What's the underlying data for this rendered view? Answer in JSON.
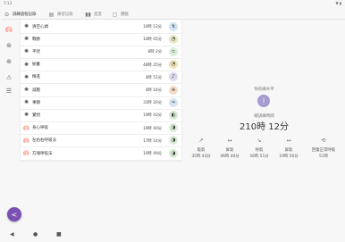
{
  "status": {
    "time": "7:13",
    "icons": "▼ ▮"
  },
  "tabs": [
    {
      "label": "訓練過程記錄",
      "icon": "⊙",
      "active": true
    },
    {
      "label": "練習記錄",
      "icon": "▤",
      "active": false
    },
    {
      "label": "進度",
      "icon": "▮▮",
      "active": false
    },
    {
      "label": "體驗",
      "icon": "▢",
      "active": false
    }
  ],
  "rail_icons": [
    "🫁",
    "⊛",
    "⊕",
    "⚠",
    "☰"
  ],
  "exercises": [
    {
      "name": "清空心頭",
      "duration": "10時 13分",
      "icon": "✺",
      "circle_color": "#cfe3f4",
      "circle_icon": "↯"
    },
    {
      "name": "戰勝",
      "duration": "10時 45分",
      "icon": "✺",
      "circle_color": "#e8e6c3",
      "circle_icon": "◔"
    },
    {
      "name": "平伏",
      "duration": "6時 2分",
      "icon": "✺",
      "circle_color": "#d9edd9",
      "circle_icon": "⊂"
    },
    {
      "name": "振奮",
      "duration": "46時 25分",
      "icon": "✺",
      "circle_color": "#efe2b8",
      "circle_icon": "◔"
    },
    {
      "name": "精進",
      "duration": "4時 51分",
      "icon": "✺",
      "circle_color": "#dcd7ef",
      "circle_icon": "♪"
    },
    {
      "name": "減壓",
      "duration": "4時 16分",
      "icon": "✺",
      "circle_color": "#f4dcc6",
      "circle_icon": "≋"
    },
    {
      "name": "事靜",
      "duration": "31時 20分",
      "icon": "✺",
      "circle_color": "#d5e2f2",
      "circle_icon": "≈"
    },
    {
      "name": "覺悟",
      "duration": "19時 43分",
      "icon": "✺",
      "circle_color": "#d3ead0",
      "circle_icon": "◐"
    },
    {
      "name": "身心呼吸",
      "duration": "19時 40分",
      "icon": "🫁",
      "circle_color": "#d9ecd6",
      "circle_icon": "◑"
    },
    {
      "name": "左右右呼吸法",
      "duration": "17時 14分",
      "icon": "🫁",
      "circle_color": "#d9ecd6",
      "circle_icon": "◑"
    },
    {
      "name": "方塊呼吸法",
      "duration": "10時 49分",
      "icon": "🫁",
      "circle_color": "#d9ecd6",
      "circle_icon": "◑"
    }
  ],
  "summary": {
    "level_label": "你的練水平",
    "level_value": "I",
    "total_label": "總訓練時間",
    "total_value": "210時 12分"
  },
  "stats": [
    {
      "icon": "↗",
      "label": "吸氣",
      "value": "35時 43分"
    },
    {
      "icon": "↔",
      "label": "屏氣",
      "value": "46時 40分"
    },
    {
      "icon": "↘",
      "label": "呼氣",
      "value": "56時 51分"
    },
    {
      "icon": "↔",
      "label": "屏氣",
      "value": "19時 56分"
    },
    {
      "icon": "⟲",
      "label": "回復正常呼吸",
      "value": "51時"
    }
  ],
  "nav": {
    "back": "◀",
    "home": "●",
    "recents": "■"
  },
  "fab_icon": "<"
}
